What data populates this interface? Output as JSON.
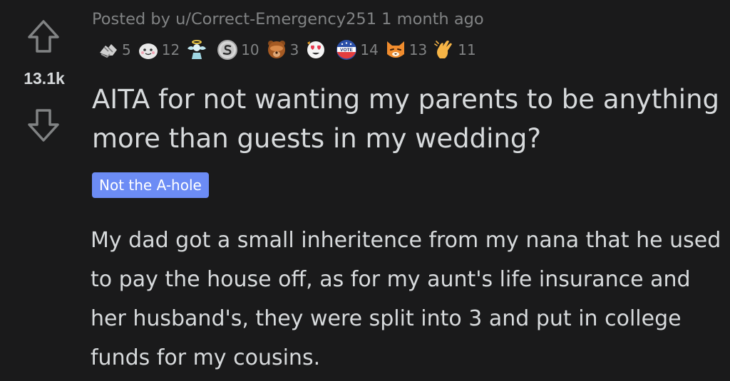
{
  "post": {
    "score": "13.1k",
    "meta": "Posted by u/Correct-Emergency251 1 month ago",
    "title": "AITA for not wanting my parents to be anything more than guests in my wedding?",
    "flair": "Not the A-hole",
    "body": "My dad got a small inheritence from my nana that he used to pay the house off, as for my aunt's life insurance and her husband's, they were split into 3 and put in college funds for my cousins."
  },
  "awards": [
    {
      "icon": "helping-hands-icon",
      "count": "5"
    },
    {
      "icon": "wholesome-seal-icon",
      "count": "12"
    },
    {
      "icon": "angel-icon",
      "count": ""
    },
    {
      "icon": "silver-coin-icon",
      "count": "10"
    },
    {
      "icon": "bear-facepalm-icon",
      "count": "3"
    },
    {
      "icon": "heart-eyes-icon",
      "count": ""
    },
    {
      "icon": "vote-badge-icon",
      "count": "14"
    },
    {
      "icon": "cat-icon",
      "count": "13"
    },
    {
      "icon": "clapping-hand-icon",
      "count": "11"
    }
  ],
  "colors": {
    "background": "#1a1a1b",
    "text": "#d7dadc",
    "muted": "#818384",
    "flair_bg": "#6c8cf5"
  }
}
